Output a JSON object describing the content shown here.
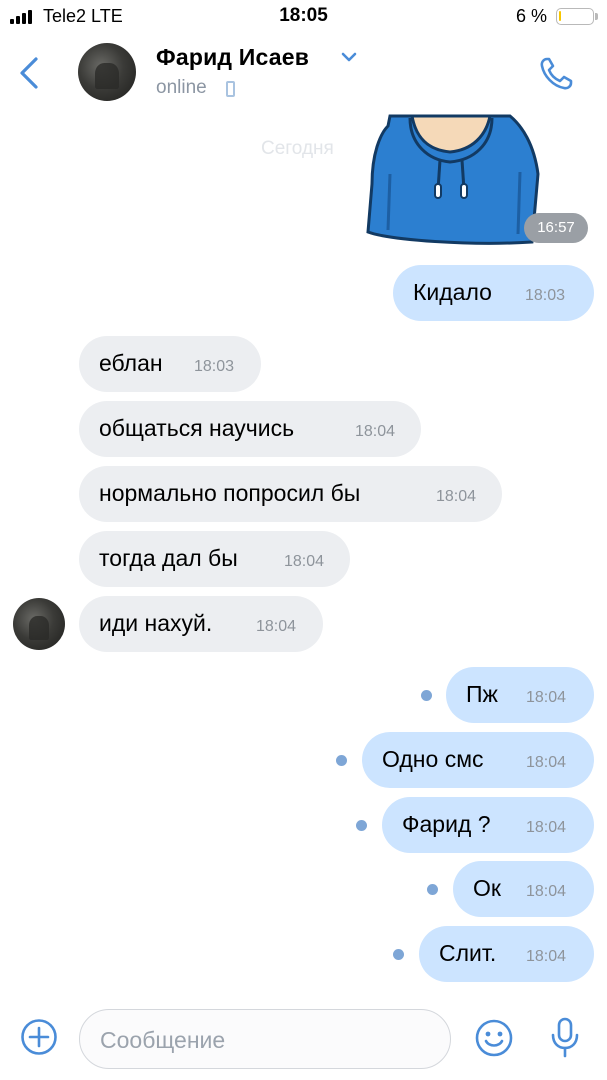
{
  "status_bar": {
    "carrier": "Tele2  LTE",
    "time": "18:05",
    "battery_percent": "6 %",
    "battery_level": 0.06
  },
  "header": {
    "contact_name": "Фарид Исаев",
    "presence": "online"
  },
  "chat": {
    "date_separator": "Сегодня",
    "sticker_time": "16:57",
    "messages": [
      {
        "text": "Кидало",
        "time": "18:03",
        "direction": "out"
      },
      {
        "text": "еблан",
        "time": "18:03",
        "direction": "in"
      },
      {
        "text": "общаться научись",
        "time": "18:04",
        "direction": "in"
      },
      {
        "text": "нормально попросил бы",
        "time": "18:04",
        "direction": "in"
      },
      {
        "text": "тогда дал бы",
        "time": "18:04",
        "direction": "in"
      },
      {
        "text": "иди нахуй.",
        "time": "18:04",
        "direction": "in"
      },
      {
        "text": "Пж",
        "time": "18:04",
        "direction": "out",
        "unread": true
      },
      {
        "text": "Одно смс",
        "time": "18:04",
        "direction": "out",
        "unread": true
      },
      {
        "text": "Фарид ?",
        "time": "18:04",
        "direction": "out",
        "unread": true
      },
      {
        "text": "Ок",
        "time": "18:04",
        "direction": "out",
        "unread": true
      },
      {
        "text": "Слит.",
        "time": "18:04",
        "direction": "out",
        "unread": true
      }
    ]
  },
  "composer": {
    "placeholder": "Сообщение"
  },
  "icons": {
    "back": "chevron-left-icon",
    "dropdown": "chevron-down-icon",
    "call": "phone-icon",
    "attach": "plus-circle-icon",
    "emoji": "smile-icon",
    "voice": "microphone-icon"
  },
  "colors": {
    "accent": "#4a8cd8",
    "incoming_bubble": "#eceef1",
    "outgoing_bubble": "#cce4ff",
    "unread_dot": "#7ea6d6",
    "battery": "#f7c600"
  }
}
